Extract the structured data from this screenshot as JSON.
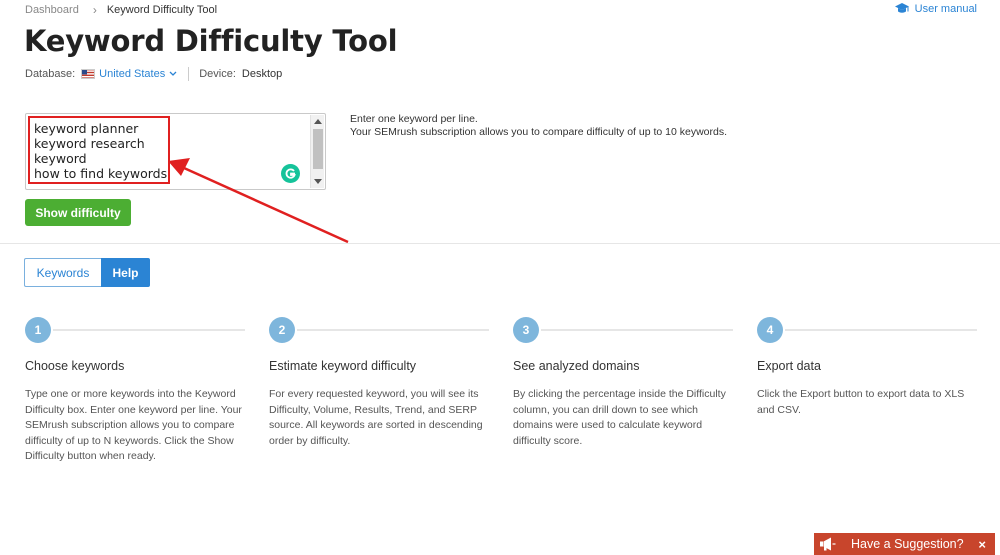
{
  "breadcrumb": {
    "home": "Dashboard",
    "current": "Keyword Difficulty Tool"
  },
  "header": {
    "user_manual": "User manual",
    "title": "Keyword Difficulty Tool"
  },
  "meta": {
    "database_label": "Database:",
    "database_value": "United States",
    "device_label": "Device:",
    "device_value": "Desktop"
  },
  "input": {
    "keywords": [
      "keyword planner",
      "keyword research",
      "keyword",
      "how to find keywords"
    ]
  },
  "hint": {
    "line1": "Enter one keyword per line.",
    "line2": "Your SEMrush subscription allows you to compare difficulty of up to 10 keywords."
  },
  "actions": {
    "show_difficulty": "Show difficulty"
  },
  "tabs": {
    "keywords": "Keywords",
    "help": "Help"
  },
  "steps": [
    {
      "num": "1",
      "title": "Choose keywords",
      "desc": "Type one or more keywords into the Keyword Difficulty box. Enter one keyword per line. Your SEMrush subscription allows you to compare difficulty of up to N keywords. Click the Show Difficulty button when ready."
    },
    {
      "num": "2",
      "title": "Estimate keyword difficulty",
      "desc": "For every requested keyword, you will see its Difficulty, Volume, Results, Trend, and SERP source. All keywords are sorted in descending order by difficulty."
    },
    {
      "num": "3",
      "title": "See analyzed domains",
      "desc": "By clicking the percentage inside the Difficulty column, you can drill down to see which domains were used to calculate keyword difficulty score."
    },
    {
      "num": "4",
      "title": "Export data",
      "desc": "Click the Export button to export data to XLS and CSV."
    }
  ],
  "suggestion": {
    "label": "Have a Suggestion?",
    "close": "×"
  },
  "colors": {
    "accent_blue": "#2b84d4",
    "button_green": "#4cae33",
    "annotation_red": "#e02020",
    "suggest_bg": "#c8452c",
    "step_circle": "#7eb6dc"
  }
}
